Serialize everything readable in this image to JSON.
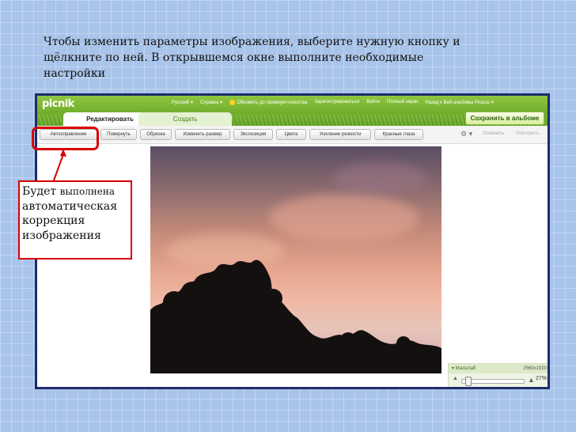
{
  "instruction": {
    "line1": "Чтобы изменить параметры изображения, выберите нужную кнопку и",
    "line2": "щёлкните по ней. В открывшемся окне выполните необходимые",
    "line3": "настройки"
  },
  "app": {
    "logo": "picnik",
    "topnav": [
      "Русский ▾",
      "Справка ▾",
      "Обновить до премиум-членства",
      "Зарегистрироваться",
      "Войти",
      "Полный экран",
      "Назад к Веб-альбомы Picasa ✕"
    ],
    "tabs": {
      "edit": "Редактировать",
      "create": "Создать"
    },
    "save_button": "Сохранить в альбоме",
    "tools": [
      "Автосправление",
      "Повернуть",
      "Обрезка",
      "Изменить размер",
      "Экспозиция",
      "Цвета",
      "Усиление резкости",
      "Красные глаза"
    ],
    "gear": "⚙ ▾",
    "undo": "Отменить",
    "redo": "Повторить",
    "zoom": {
      "label": "▾ Масштаб",
      "resolution": "2560x1920",
      "percent": "27%",
      "level": 0.27
    }
  },
  "callout": {
    "word1": "Будет",
    "word2": "выполнена",
    "line2": "автоматическая",
    "line3": "коррекция",
    "line4": "изображения"
  },
  "colors": {
    "accent_red": "#d90000",
    "frame": "#1f2c6b",
    "picnik_green": "#6aa829"
  }
}
